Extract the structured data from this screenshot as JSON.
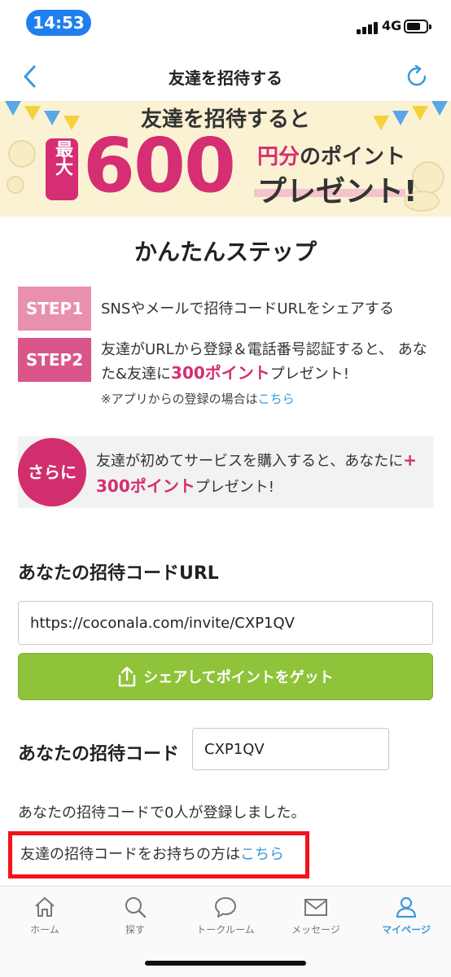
{
  "status_bar": {
    "time": "14:53",
    "network": "4G"
  },
  "nav": {
    "title": "友達を招待する"
  },
  "banner": {
    "headline": "友達を招待すると",
    "max_label": "最大",
    "amount": "600",
    "unit_text": "円分",
    "unit_suffix": "のポイント",
    "present_text": "プレゼント!"
  },
  "steps_section": {
    "title": "かんたんステップ",
    "step1": {
      "badge": "STEP1",
      "text": "SNSやメールで招待コードURLをシェアする"
    },
    "step2": {
      "badge": "STEP2",
      "text_before": "友達がURLから登録＆電話番号認証すると、 あなた&友達に",
      "points": "300ポイント",
      "text_after": "プレゼント!"
    },
    "note_text": "※アプリからの登録の場合は",
    "note_link": "こちら"
  },
  "bonus": {
    "badge": "さらに",
    "text_before": "友達が初めてサービスを購入すると、あなたに",
    "plus": "+",
    "points": "300ポイント",
    "text_after": "プレゼント!"
  },
  "invite_url": {
    "label": "あなたの招待コードURL",
    "value": "https://coconala.com/invite/CXP1QV",
    "share_button": "シェアしてポイントをゲット"
  },
  "invite_code": {
    "label": "あなたの招待コード",
    "value": "CXP1QV",
    "registered_text": "あなたの招待コードで0人が登録しました。"
  },
  "have_code": {
    "text": "友達の招待コードをお持ちの方は",
    "link": "こちら"
  },
  "tabs": [
    {
      "label": "ホーム",
      "icon": "home-icon"
    },
    {
      "label": "探す",
      "icon": "search-icon"
    },
    {
      "label": "トークルーム",
      "icon": "chat-icon"
    },
    {
      "label": "メッセージ",
      "icon": "mail-icon"
    },
    {
      "label": "マイページ",
      "icon": "person-icon"
    }
  ],
  "colors": {
    "accent_pink": "#d52e72",
    "link_blue": "#3b9ad9",
    "share_green": "#8fc33a",
    "highlight_red": "#f2131a"
  }
}
